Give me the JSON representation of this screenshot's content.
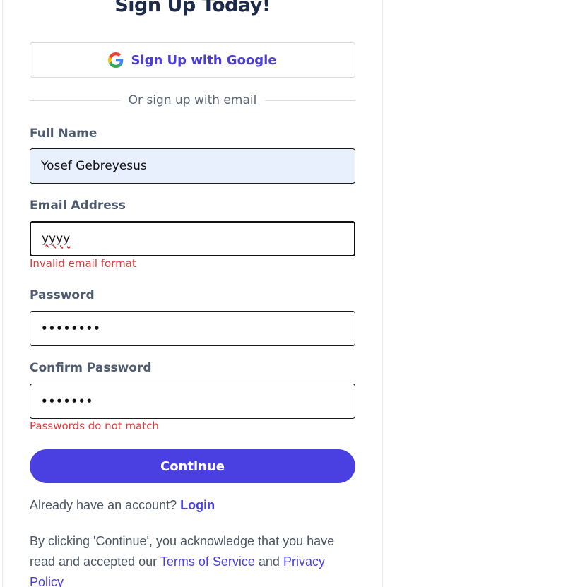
{
  "form": {
    "title": "Sign Up Today!",
    "google_button": "Sign Up with Google",
    "divider_text": "Or sign up with email",
    "fields": {
      "full_name": {
        "label": "Full Name",
        "value": "Yosef Gebreyesus"
      },
      "email": {
        "label": "Email Address",
        "value": "yyyy",
        "error": "Invalid email format"
      },
      "password": {
        "label": "Password",
        "value": "••••••••"
      },
      "confirm_password": {
        "label": "Confirm Password",
        "value": "•••••••",
        "error": "Passwords do not match"
      }
    },
    "continue_button": "Continue",
    "login_prompt": "Already have an account?",
    "login_link": "Login",
    "legal": {
      "prefix": "By clicking 'Continue', you acknowledge that you have read and accepted our",
      "terms_link": "Terms of Service",
      "and": "and",
      "privacy_link": "Privacy Policy"
    }
  },
  "colors": {
    "accent": "#4a3fe0",
    "error": "#e5383b",
    "autofill_bg": "#e8f0fe"
  }
}
